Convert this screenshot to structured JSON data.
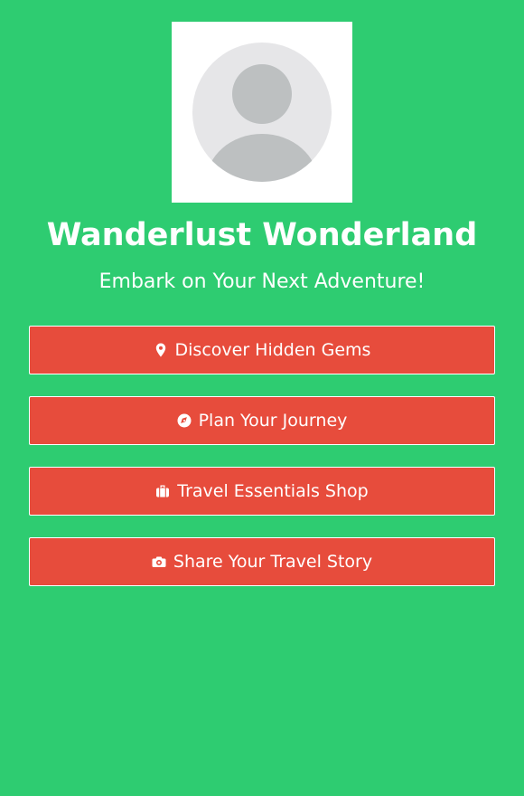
{
  "profile": {
    "title": "Wanderlust Wonderland",
    "subtitle": "Embark on Your Next Adventure!",
    "avatar_icon": "default-user-avatar"
  },
  "links": [
    {
      "label": "Discover Hidden Gems",
      "icon": "map-marker-icon"
    },
    {
      "label": "Plan Your Journey",
      "icon": "compass-icon"
    },
    {
      "label": "Travel Essentials Shop",
      "icon": "suitcase-icon"
    },
    {
      "label": "Share Your Travel Story",
      "icon": "camera-icon"
    }
  ],
  "colors": {
    "background": "#2ecc71",
    "button": "#e74c3c",
    "text": "#ffffff"
  }
}
